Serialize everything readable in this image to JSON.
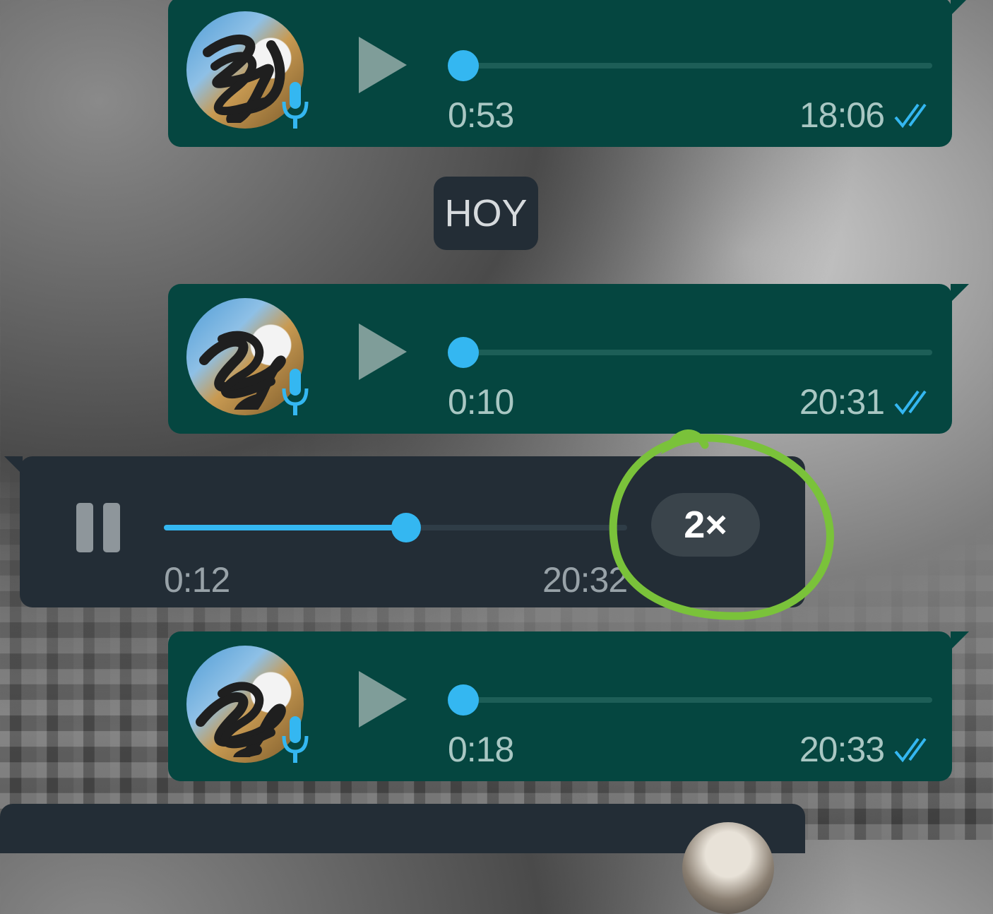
{
  "messages": [
    {
      "type": "outgoing-voice",
      "duration": "0:53",
      "time": "18:06",
      "progress": 0,
      "status": "read"
    },
    {
      "type": "date-separator",
      "label": "HOY"
    },
    {
      "type": "outgoing-voice",
      "duration": "0:10",
      "time": "20:31",
      "progress": 0,
      "status": "read"
    },
    {
      "type": "incoming-voice",
      "duration": "0:12",
      "time": "20:32",
      "progress": 0.55,
      "speed": "2×",
      "playing": true
    },
    {
      "type": "outgoing-voice",
      "duration": "0:18",
      "time": "20:33",
      "progress": 0,
      "status": "read"
    }
  ],
  "colors": {
    "outgoing_bubble": "#054640",
    "incoming_bubble": "#232d36",
    "accent": "#34b7f1",
    "highlight_annotation": "#7ac23a"
  },
  "icons": {
    "play": "play-icon",
    "pause": "pause-icon",
    "mic": "mic-icon",
    "read_receipt": "double-check-icon"
  }
}
